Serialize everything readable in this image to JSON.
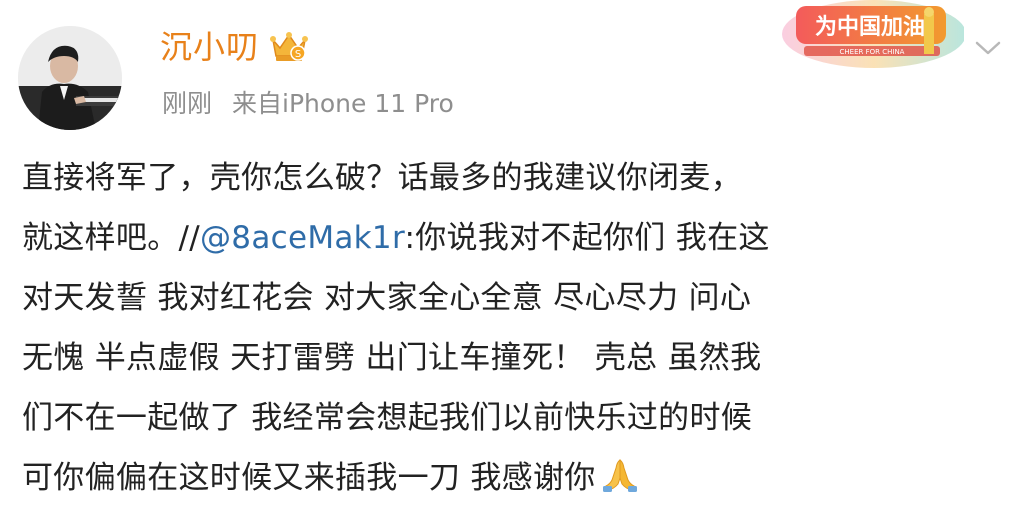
{
  "post": {
    "author": {
      "name": "沉小叨",
      "avatar_icon": "avatar-pianist",
      "vip_badge_icon": "crown-badge-icon"
    },
    "meta": {
      "time": "刚刚",
      "source": "来自iPhone 11 Pro"
    },
    "banner": {
      "text": "为中国加油",
      "subtext": "CHEER FOR CHINA"
    },
    "body": {
      "line1": "直接将军了，壳你怎么破？话最多的我建议你闭麦，",
      "line2_prefix": "就这样吧。//",
      "mention": "@8aceMak1r",
      "line2_suffix": ":你说我对不起你们 我在这",
      "line3": "对天发誓 我对红花会 对大家全心全意 尽心尽力 问心",
      "line4": "无愧 半点虚假 天打雷劈 出门让车撞死！ 壳总 虽然我",
      "line5": "们不在一起做了 我经常会想起我们以前快乐过的时候",
      "line6": "可你偏偏在这时候又来插我一刀 我感谢你",
      "end_emoji_icon": "praying-hands-icon"
    },
    "colors": {
      "username": "#e8811a",
      "meta": "#8e8e8e",
      "mention": "#2f6ca8",
      "text": "#222222"
    }
  }
}
